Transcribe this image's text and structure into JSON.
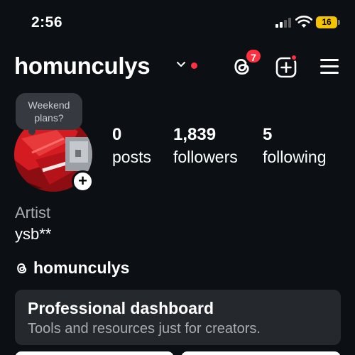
{
  "status_bar": {
    "time": "2:56",
    "battery": "16"
  },
  "header": {
    "username": "homunculys"
  },
  "notifications": {
    "threads_count": "7"
  },
  "note": {
    "text": "Weekend plans?"
  },
  "stats": [
    {
      "value": "0",
      "label": "posts"
    },
    {
      "value": "1,839",
      "label": "followers"
    },
    {
      "value": "5",
      "label": "following"
    }
  ],
  "bio": {
    "category": "Artist",
    "name": "ysb**",
    "threads_handle": "homunculys"
  },
  "dashboard": {
    "title": "Professional dashboard",
    "subtitle": "Tools and resources just for creators."
  },
  "colors": {
    "background": "#0c1014",
    "accent_red": "#ff3040",
    "card": "#25292e",
    "battery": "#f5c400"
  },
  "icons": [
    "signal-icon",
    "wifi-icon",
    "battery-icon",
    "chevron-down-icon",
    "threads-icon",
    "create-icon",
    "menu-icon",
    "add-story-icon"
  ]
}
